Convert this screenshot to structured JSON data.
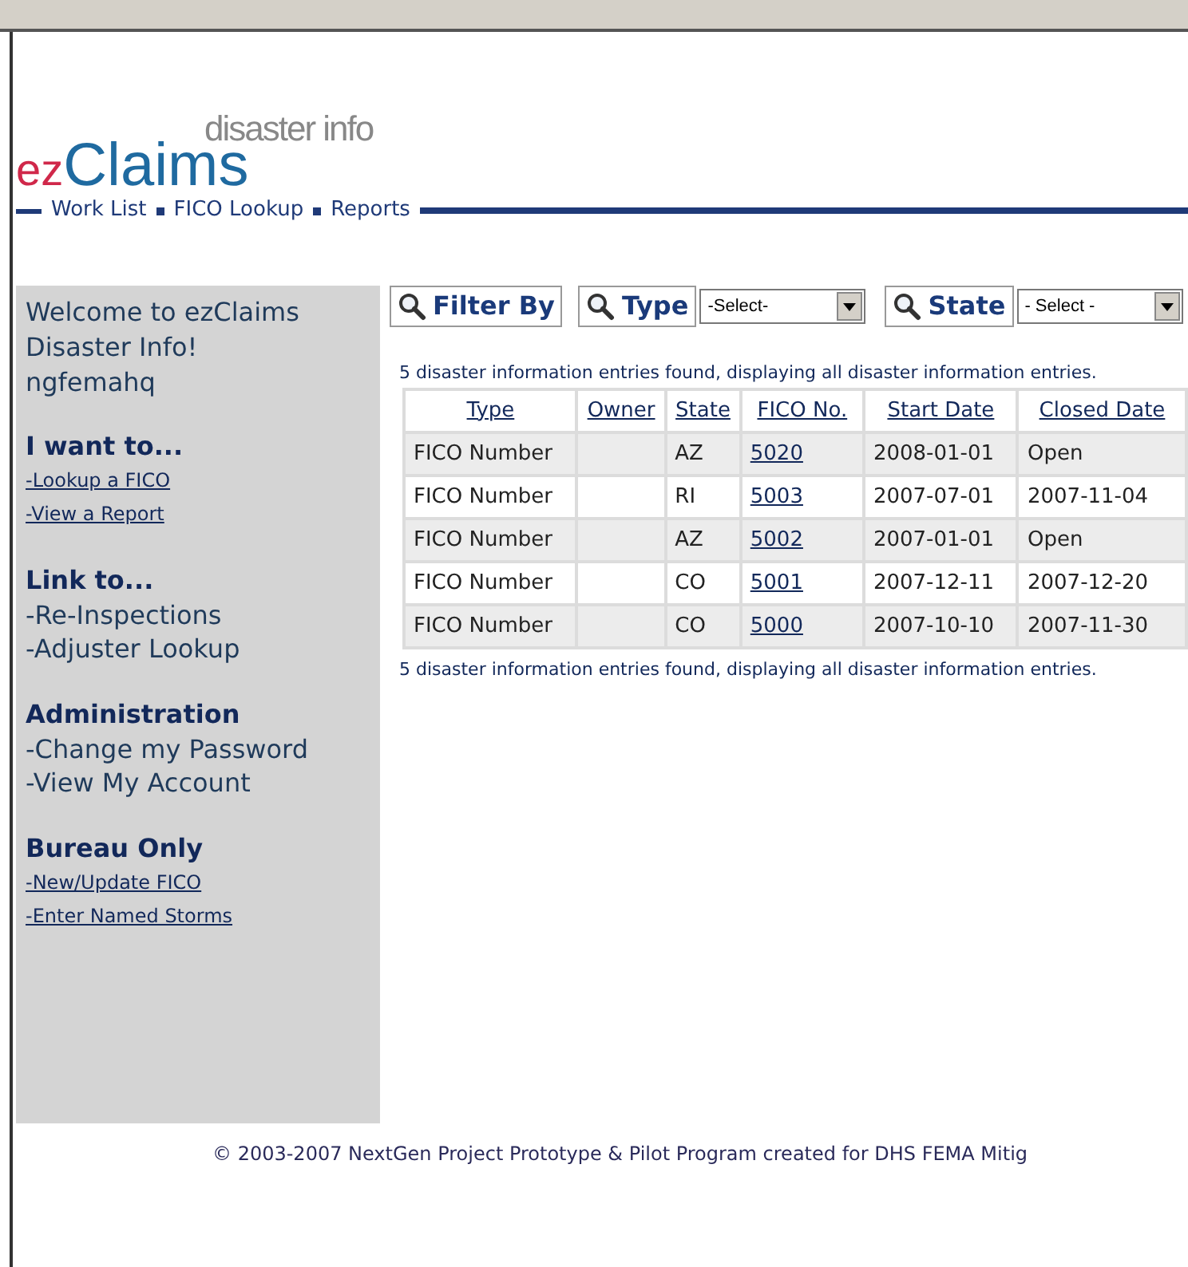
{
  "logo": {
    "prefix": "ez",
    "name": "Claims",
    "tagline": "disaster info"
  },
  "nav": [
    "Work List",
    "FICO Lookup",
    "Reports"
  ],
  "sidebar": {
    "welcome": [
      "Welcome to ezClaims",
      "Disaster Info!",
      "ngfemahq"
    ],
    "sections": [
      {
        "title": "I want to...",
        "kind": "small",
        "links": [
          "-Lookup a FICO",
          "-View a Report"
        ]
      },
      {
        "title": "Link to...",
        "kind": "plain",
        "links": [
          "-Re-Inspections",
          "-Adjuster Lookup"
        ]
      },
      {
        "title": "Administration",
        "kind": "plain",
        "links": [
          "-Change my Password",
          "-View My Account"
        ]
      },
      {
        "title": "Bureau Only",
        "kind": "small",
        "links": [
          "-New/Update FICO",
          "-Enter Named Storms"
        ]
      }
    ]
  },
  "filters": {
    "filter_by": "Filter By",
    "type": {
      "label": "Type",
      "value": "-Select-"
    },
    "state": {
      "label": "State",
      "value": "- Select -"
    }
  },
  "summary_top": "5 disaster information entries found, displaying all disaster information entries.",
  "table": {
    "columns": [
      "Type",
      "Owner",
      "State",
      "FICO No.",
      "Start Date",
      "Closed Date"
    ],
    "rows": [
      [
        "FICO Number",
        "",
        "AZ",
        "5020",
        "2008-01-01",
        "Open"
      ],
      [
        "FICO Number",
        "",
        "RI",
        "5003",
        "2007-07-01",
        "2007-11-04"
      ],
      [
        "FICO Number",
        "",
        "AZ",
        "5002",
        "2007-01-01",
        "Open"
      ],
      [
        "FICO Number",
        "",
        "CO",
        "5001",
        "2007-12-11",
        "2007-12-20"
      ],
      [
        "FICO Number",
        "",
        "CO",
        "5000",
        "2007-10-10",
        "2007-11-30"
      ]
    ]
  },
  "summary_bottom": "5 disaster information entries found, displaying all disaster information entries.",
  "footer": "© 2003-2007 NextGen Project Prototype & Pilot Program created for DHS FEMA Mitig"
}
